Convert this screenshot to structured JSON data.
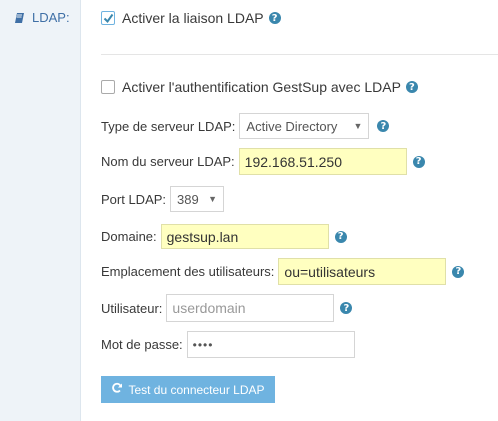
{
  "section": {
    "label": "LDAP:"
  },
  "enable_ldap": {
    "label": "Activer la liaison LDAP",
    "checked": true
  },
  "enable_auth": {
    "label": "Activer l'authentification GestSup avec LDAP",
    "checked": false
  },
  "server_type": {
    "label": "Type de serveur LDAP:",
    "value": "Active Directory"
  },
  "server_name": {
    "label": "Nom du serveur LDAP:",
    "value": "192.168.51.250"
  },
  "port": {
    "label": "Port LDAP:",
    "value": "389"
  },
  "domain": {
    "label": "Domaine:",
    "value": "gestsup.lan"
  },
  "users_location": {
    "label": "Emplacement des utilisateurs:",
    "value": "ou=utilisateurs"
  },
  "user": {
    "label": "Utilisateur:",
    "placeholder": "userdomain"
  },
  "password": {
    "label": "Mot de passe:",
    "value": "••••"
  },
  "test_button": {
    "label": "Test du connecteur LDAP"
  },
  "help_glyph": "?",
  "colors": {
    "accent": "#6fb3e0",
    "help": "#3a87ad",
    "highlight": "#ffffc0",
    "label_blue": "#3f6fa6"
  }
}
